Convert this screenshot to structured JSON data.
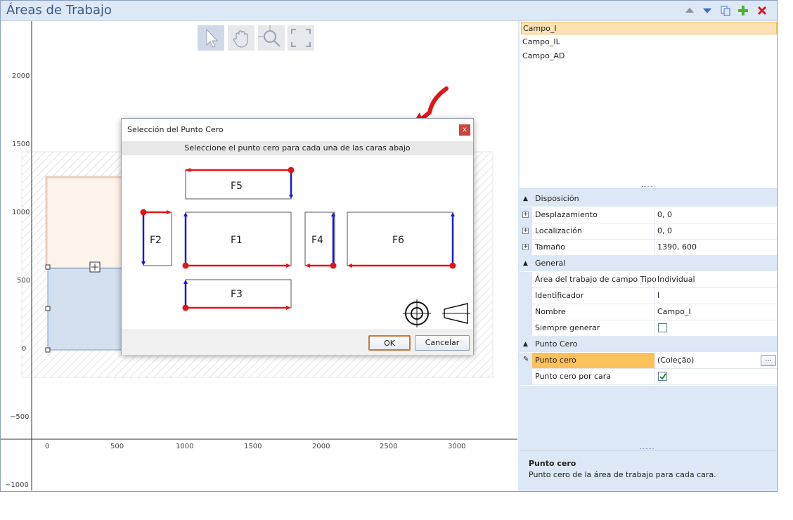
{
  "window": {
    "title": "Áreas de Trabajo"
  },
  "toolbar_icons": [
    "move-up-icon",
    "move-down-icon",
    "copy-icon",
    "add-icon",
    "delete-icon"
  ],
  "canvas_tools": [
    "select-tool",
    "pan-tool",
    "zoom-tool",
    "fit-tool"
  ],
  "axes": {
    "y_ticks": [
      "2000",
      "1500",
      "1000",
      "500",
      "0",
      "−500",
      "−1000"
    ],
    "x_ticks": [
      "0",
      "500",
      "1000",
      "1500",
      "2000",
      "2500",
      "3000"
    ]
  },
  "list": {
    "items": [
      "Campo_I",
      "Campo_IL",
      "Campo_AD"
    ],
    "selected_index": 0
  },
  "properties": {
    "cat_disposicion": "Disposición",
    "desplazamiento_label": "Desplazamiento",
    "desplazamiento_value": "0, 0",
    "localizacion_label": "Localización",
    "localizacion_value": "0, 0",
    "tamano_label": "Tamaño",
    "tamano_value": "1390, 600",
    "cat_general": "General",
    "tipo_label": "Área del trabajo de campo Tipo",
    "tipo_value": "Individual",
    "identificador_label": "Identificador",
    "identificador_value": "I",
    "nombre_label": "Nombre",
    "nombre_value": "Campo_I",
    "siempre_label": "Siempre generar",
    "siempre_checked": false,
    "cat_punto": "Punto Cero",
    "punto_label": "Punto cero",
    "punto_value": "(Coleção)",
    "punto_btn": "...",
    "porcara_label": "Punto cero por cara",
    "porcara_checked": true
  },
  "description": {
    "title": "Punto cero",
    "text": "Punto cero de la área de trabajo para cada cara."
  },
  "dialog": {
    "title": "Selección del Punto Cero",
    "close": "x",
    "subtitle": "Seleccione el punto cero para cada una de las caras abajo",
    "faces": [
      "F5",
      "F2",
      "F1",
      "F4",
      "F6",
      "F3"
    ],
    "ok": "OK",
    "cancel": "Cancelar"
  },
  "colors": {
    "accent_red": "#e0161b",
    "accent_blue": "#1a1ad0",
    "selection": "#fbc15c",
    "panel": "#dce8f5"
  }
}
